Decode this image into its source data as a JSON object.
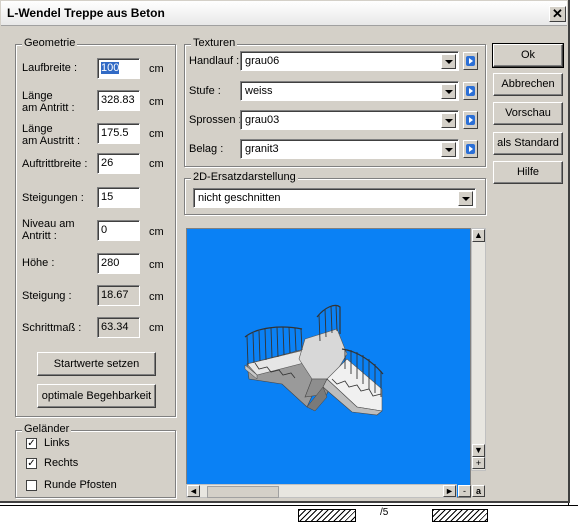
{
  "dialog": {
    "title": "L-Wendel Treppe aus Beton",
    "close_glyph": "✕"
  },
  "geometrie": {
    "group_label": "Geometrie",
    "fields": [
      {
        "label": "Laufbreite :",
        "value": "100",
        "unit": "cm",
        "selected": true,
        "readonly": false
      },
      {
        "label": "Länge\nam Antritt :",
        "value": "328.83",
        "unit": "cm",
        "readonly": false
      },
      {
        "label": "Länge\nam Austritt :",
        "value": "175.5",
        "unit": "cm",
        "readonly": false
      },
      {
        "label": "Auftrittbreite :",
        "value": "26",
        "unit": "cm",
        "readonly": false
      },
      {
        "label": "Steigungen :",
        "value": "15",
        "unit": "",
        "readonly": false
      },
      {
        "label": "Niveau am\nAntritt :",
        "value": "0",
        "unit": "cm",
        "readonly": false
      },
      {
        "label": "Höhe :",
        "value": "280",
        "unit": "cm",
        "readonly": false
      },
      {
        "label": "Steigung :",
        "value": "18.67",
        "unit": "cm",
        "readonly": true
      },
      {
        "label": "Schrittmaß :",
        "value": "63.34",
        "unit": "cm",
        "readonly": true
      }
    ],
    "startwerte_button": "Startwerte setzen",
    "optimal_button": "optimale Begehbarkeit"
  },
  "gelaender": {
    "group_label": "Geländer",
    "links": {
      "label": "Links",
      "checked": true
    },
    "rechts": {
      "label": "Rechts",
      "checked": true
    },
    "runde_pfosten": {
      "label": "Runde Pfosten",
      "checked": false
    },
    "check_glyph": "✓"
  },
  "texturen": {
    "group_label": "Texturen",
    "rows": [
      {
        "label": "Handlauf :",
        "value": "grau06"
      },
      {
        "label": "Stufe :",
        "value": "weiss"
      },
      {
        "label": "Sprossen :",
        "value": "grau03"
      },
      {
        "label": "Belag :",
        "value": "granit3"
      }
    ]
  },
  "ersatz": {
    "group_label": "2D-Ersatzdarstellung",
    "value": "nicht geschnitten"
  },
  "buttons": {
    "ok": "Ok",
    "abbrechen": "Abbrechen",
    "vorschau": "Vorschau",
    "als_standard": "als Standard",
    "hilfe": "Hilfe"
  },
  "preview": {
    "background_color": "#0a81f5",
    "scroll_up": "▲",
    "scroll_down": "▼",
    "zoom_in": "+",
    "zoom_out": "-",
    "scroll_left": "◄",
    "scroll_right": "►",
    "a_glyph": "a"
  },
  "background_app": {
    "fragment": "/5"
  }
}
